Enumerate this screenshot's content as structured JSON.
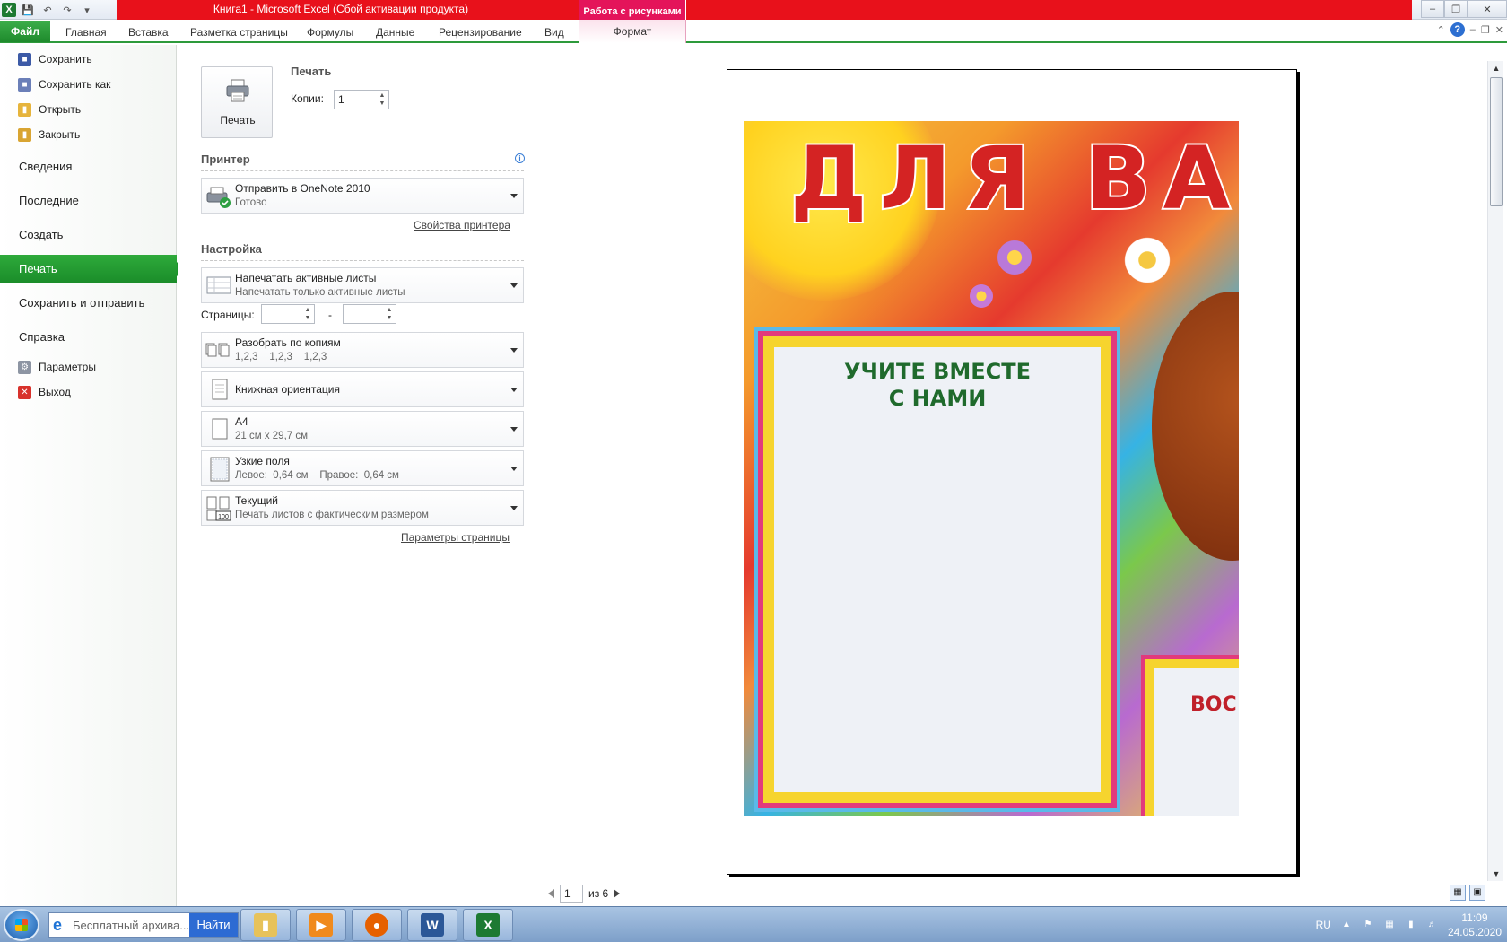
{
  "window": {
    "title": "Книга1  -  Microsoft Excel (Сбой активации продукта)",
    "context_group": "Работа с рисунками"
  },
  "ribbon": {
    "file_tab": "Файл",
    "tabs": [
      "Главная",
      "Вставка",
      "Разметка страницы",
      "Формулы",
      "Данные",
      "Рецензирование",
      "Вид"
    ],
    "context_tab": "Формат"
  },
  "backstage": {
    "small_items": [
      {
        "label": "Сохранить",
        "icon": "save-icon"
      },
      {
        "label": "Сохранить как",
        "icon": "save-as-icon"
      },
      {
        "label": "Открыть",
        "icon": "open-folder-icon"
      },
      {
        "label": "Закрыть",
        "icon": "close-folder-icon"
      }
    ],
    "big_items": [
      "Сведения",
      "Последние",
      "Создать",
      "Печать",
      "Сохранить и отправить",
      "Справка"
    ],
    "active": "Печать",
    "bottom_items": [
      {
        "label": "Параметры",
        "icon": "options-icon"
      },
      {
        "label": "Выход",
        "icon": "exit-icon"
      }
    ]
  },
  "print": {
    "section_title": "Печать",
    "button_label": "Печать",
    "copies_label": "Копии:",
    "copies_value": "1",
    "printer_title": "Принтер",
    "printer_name": "Отправить в OneNote 2010",
    "printer_status": "Готово",
    "printer_props_link": "Свойства принтера",
    "settings_title": "Настройка",
    "what_to_print": "Напечатать активные листы",
    "what_to_print_sub": "Напечатать только активные листы",
    "pages_label": "Страницы:",
    "pages_dash": "-",
    "collate": "Разобрать по копиям",
    "collate_sub": "1,2,3    1,2,3    1,2,3",
    "orientation": "Книжная ориентация",
    "paper": "A4",
    "paper_sub": "21 см x 29,7 см",
    "margins": "Узкие поля",
    "margins_sub": "Левое:  0,64 см    Правое:  0,64 см",
    "scaling": "Текущий",
    "scaling_sub": "Печать листов с фактическим размером",
    "scaling_icon_text": "100",
    "page_setup_link": "Параметры страницы"
  },
  "preview": {
    "poster_headline": "ДЛЯ ВА",
    "board_title_1": "УЧИТЕ ВМЕСТЕ",
    "board_title_2": "С НАМИ",
    "board2_title": "ВОС",
    "current_page": "1",
    "page_of": "из 6"
  },
  "taskbar": {
    "search_text": "Бесплатный архива...",
    "search_button": "Найти",
    "lang": "RU",
    "time": "11:09",
    "date": "24.05.2020"
  },
  "colors": {
    "title_red": "#e8111b",
    "context_pink": "#e4145a",
    "file_green": "#1e8a2c",
    "nav_active_green": "#2eaa3b"
  }
}
